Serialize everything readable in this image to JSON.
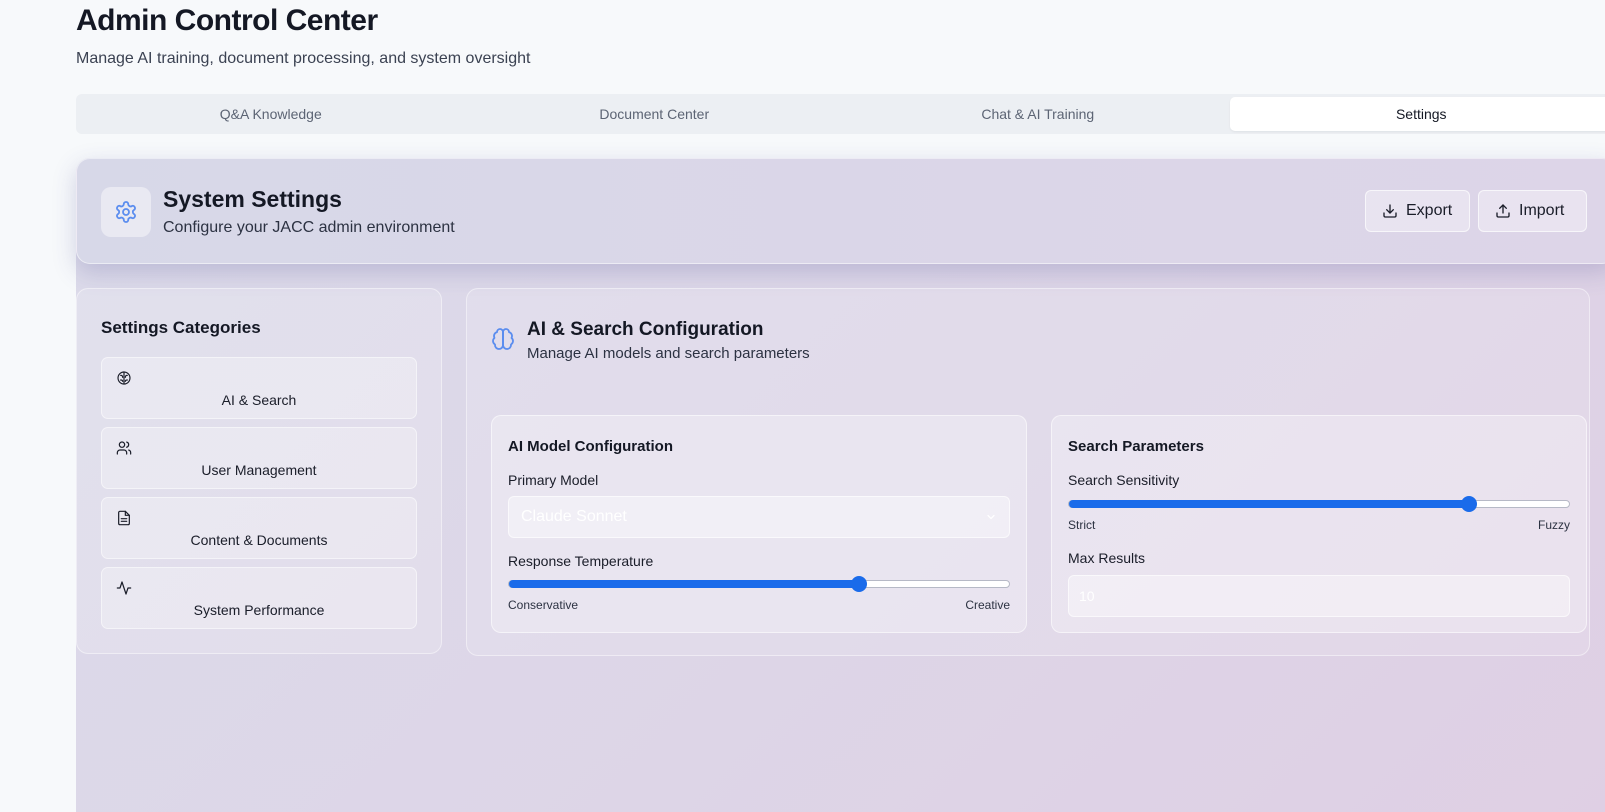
{
  "page": {
    "title": "Admin Control Center",
    "subtitle": "Manage AI training, document processing, and system oversight"
  },
  "tabs": [
    {
      "label": "Q&A Knowledge",
      "active": false
    },
    {
      "label": "Document Center",
      "active": false
    },
    {
      "label": "Chat & AI Training",
      "active": false
    },
    {
      "label": "Settings",
      "active": true
    }
  ],
  "settings_header": {
    "icon": "gear-icon",
    "title": "System Settings",
    "subtitle": "Configure your JACC admin environment",
    "export_label": "Export",
    "import_label": "Import"
  },
  "categories": {
    "title": "Settings Categories",
    "items": [
      {
        "label": "AI & Search",
        "icon": "brain-icon"
      },
      {
        "label": "User Management",
        "icon": "users-icon"
      },
      {
        "label": "Content & Documents",
        "icon": "file-text-icon"
      },
      {
        "label": "System Performance",
        "icon": "activity-icon"
      }
    ]
  },
  "config": {
    "title": "AI & Search Configuration",
    "subtitle": "Manage AI models and search parameters",
    "model_card": {
      "title": "AI Model Configuration",
      "primary_model_label": "Primary Model",
      "primary_model_value": "Claude Sonnet",
      "temperature_label": "Response Temperature",
      "temperature_value": 0.7,
      "temperature_min_label": "Conservative",
      "temperature_max_label": "Creative"
    },
    "search_card": {
      "title": "Search Parameters",
      "sensitivity_label": "Search Sensitivity",
      "sensitivity_value": 0.8,
      "sensitivity_min_label": "Strict",
      "sensitivity_max_label": "Fuzzy",
      "max_results_label": "Max Results",
      "max_results_value": "10"
    }
  },
  "colors": {
    "accent": "#1a6bea",
    "icon_blue": "#5b8def"
  }
}
